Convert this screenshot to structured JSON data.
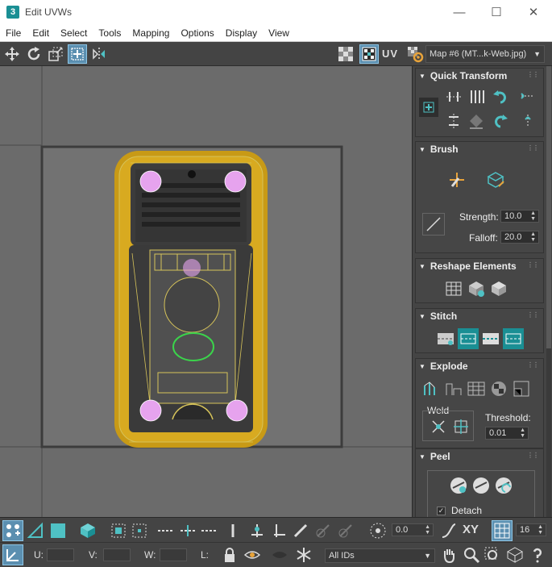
{
  "window": {
    "title": "Edit UVWs",
    "app_icon_text": "3",
    "controls": [
      "minimize",
      "maximize",
      "close"
    ]
  },
  "menu": [
    "File",
    "Edit",
    "Select",
    "Tools",
    "Mapping",
    "Options",
    "Display",
    "View"
  ],
  "toolbar": {
    "uv_label": "UV",
    "map_dropdown": "Map #6 (MT...k-Web.jpg)"
  },
  "panel": {
    "quick_transform": {
      "title": "Quick Transform"
    },
    "brush": {
      "title": "Brush",
      "strength_label": "Strength:",
      "strength_value": "10.0",
      "falloff_label": "Falloff:",
      "falloff_value": "20.0"
    },
    "reshape": {
      "title": "Reshape Elements"
    },
    "stitch": {
      "title": "Stitch"
    },
    "explode": {
      "title": "Explode",
      "weld_label": "Weld",
      "threshold_label": "Threshold:",
      "threshold_value": "0.01"
    },
    "peel": {
      "title": "Peel",
      "detach_label": "Detach",
      "detach_checked": true
    }
  },
  "bottom": {
    "offset_value": "0.0",
    "xy_label": "XY",
    "grid_value": "16",
    "u_label": "U:",
    "v_label": "V:",
    "w_label": "W:",
    "l_label": "L:",
    "ids_dropdown": "All IDs"
  },
  "colors": {
    "accent": "#1a8f94",
    "active_button": "#5b8fb0",
    "uv_outline": "#d6c35a",
    "selection_green": "#3bd44b",
    "vertex_pink": "#e6a3ee"
  }
}
